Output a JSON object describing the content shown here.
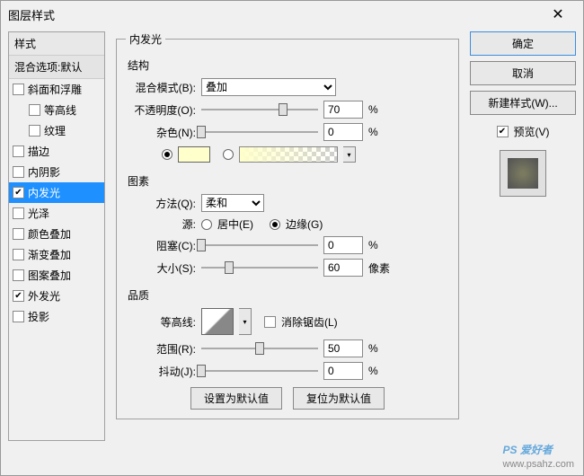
{
  "title": "图层样式",
  "sidebar": {
    "header": "样式",
    "blend_default": "混合选项:默认",
    "items": [
      {
        "label": "斜面和浮雕",
        "checked": false,
        "indent": false
      },
      {
        "label": "等高线",
        "checked": false,
        "indent": true
      },
      {
        "label": "纹理",
        "checked": false,
        "indent": true
      },
      {
        "label": "描边",
        "checked": false,
        "indent": false
      },
      {
        "label": "内阴影",
        "checked": false,
        "indent": false
      },
      {
        "label": "内发光",
        "checked": true,
        "indent": false,
        "selected": true
      },
      {
        "label": "光泽",
        "checked": false,
        "indent": false
      },
      {
        "label": "颜色叠加",
        "checked": false,
        "indent": false
      },
      {
        "label": "渐变叠加",
        "checked": false,
        "indent": false
      },
      {
        "label": "图案叠加",
        "checked": false,
        "indent": false
      },
      {
        "label": "外发光",
        "checked": true,
        "indent": false
      },
      {
        "label": "投影",
        "checked": false,
        "indent": false
      }
    ]
  },
  "panel": {
    "legend": "内发光",
    "structure": "结构",
    "blend_mode_label": "混合模式(B):",
    "blend_mode_value": "叠加",
    "opacity_label": "不透明度(O):",
    "opacity_value": "70",
    "pct": "%",
    "noise_label": "杂色(N):",
    "noise_value": "0",
    "color_swatch": "#ffffcc",
    "elements": "图素",
    "technique_label": "方法(Q):",
    "technique_value": "柔和",
    "source_label": "源:",
    "source_center": "居中(E)",
    "source_edge": "边缘(G)",
    "choke_label": "阻塞(C):",
    "choke_value": "0",
    "size_label": "大小(S):",
    "size_value": "60",
    "px": "像素",
    "quality": "品质",
    "contour_label": "等高线:",
    "antialias": "消除锯齿(L)",
    "range_label": "范围(R):",
    "range_value": "50",
    "jitter_label": "抖动(J):",
    "jitter_value": "0",
    "set_default": "设置为默认值",
    "reset_default": "复位为默认值"
  },
  "buttons": {
    "ok": "确定",
    "cancel": "取消",
    "new_style": "新建样式(W)...",
    "preview": "预览(V)"
  },
  "watermark": {
    "brand": "PS 爱好者",
    "url": "www.psahz.com"
  }
}
